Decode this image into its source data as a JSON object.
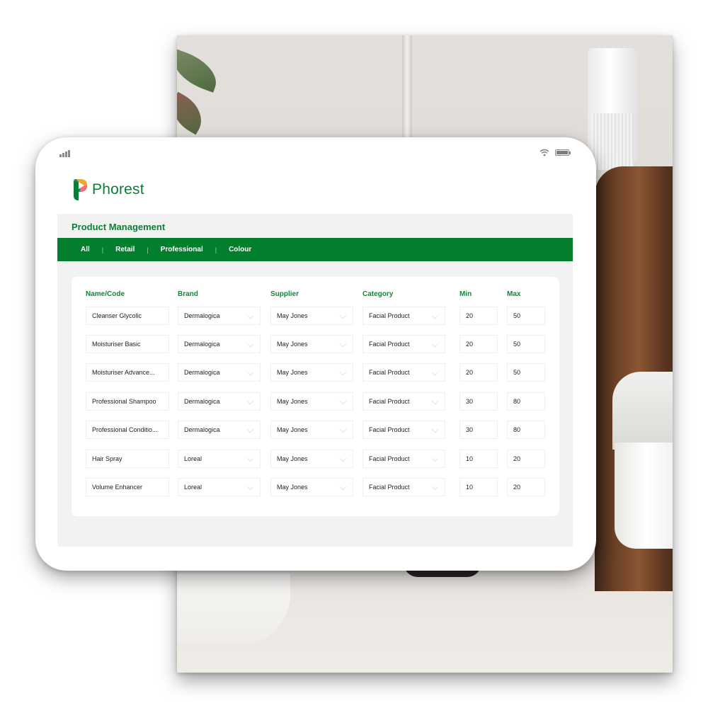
{
  "status_bar": {
    "signal_icon": "cellular-signal-icon",
    "wifi_icon": "wifi-icon",
    "battery_icon": "battery-icon"
  },
  "brand": {
    "name": "Phorest",
    "colors": {
      "primary": "#017f2c",
      "text_green": "#0b7d36",
      "logo_orange": "#f5a623",
      "logo_pink": "#f26f7c",
      "logo_teal": "#1f8a70"
    }
  },
  "page": {
    "title": "Product Management"
  },
  "tabs": [
    {
      "label": "All"
    },
    {
      "label": "Retail"
    },
    {
      "label": "Professional"
    },
    {
      "label": "Colour"
    }
  ],
  "table": {
    "columns": [
      "Name/Code",
      "Brand",
      "Supplier",
      "Category",
      "Min",
      "Max"
    ],
    "rows": [
      {
        "name": "Cleanser Glycolic",
        "brand": "Dermalogica",
        "supplier": "May Jones",
        "category": "Facial Product",
        "min": "20",
        "max": "50"
      },
      {
        "name": "Moisturiser Basic",
        "brand": "Dermalogica",
        "supplier": "May Jones",
        "category": "Facial Product",
        "min": "20",
        "max": "50"
      },
      {
        "name": "Moisturiser Advance...",
        "brand": "Dermalogica",
        "supplier": "May Jones",
        "category": "Facial Product",
        "min": "20",
        "max": "50"
      },
      {
        "name": "Professional Shampoo",
        "brand": "Dermalogica",
        "supplier": "May Jones",
        "category": "Facial Product",
        "min": "30",
        "max": "80"
      },
      {
        "name": "Professional Conditio...",
        "brand": "Dermalogica",
        "supplier": "May Jones",
        "category": "Facial Product",
        "min": "30",
        "max": "80"
      },
      {
        "name": "Hair Spray",
        "brand": "Loreal",
        "supplier": "May Jones",
        "category": "Facial Product",
        "min": "10",
        "max": "20"
      },
      {
        "name": "Volume Enhancer",
        "brand": "Loreal",
        "supplier": "May Jones",
        "category": "Facial Product",
        "min": "10",
        "max": "20"
      }
    ]
  }
}
